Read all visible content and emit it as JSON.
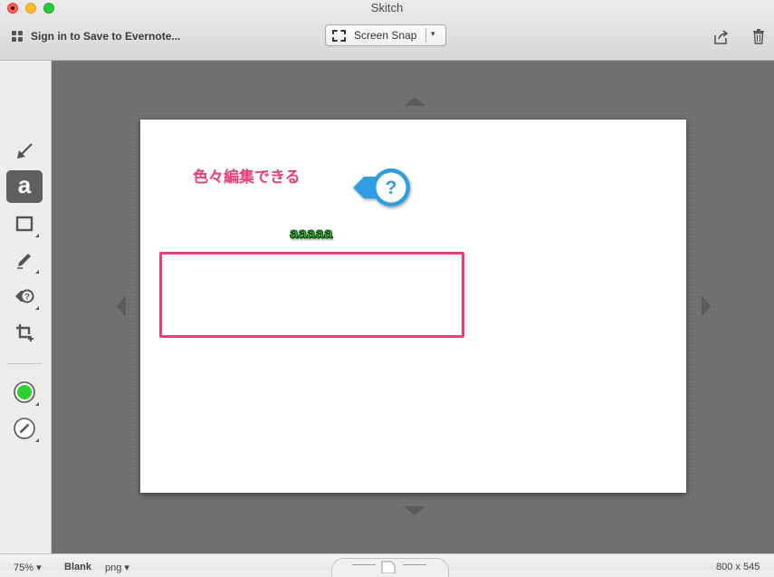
{
  "window": {
    "title": "Skitch"
  },
  "toolbar": {
    "signin_label": "Sign in to Save to Evernote...",
    "snap_label": "Screen Snap",
    "snap_arrow": "▾"
  },
  "palette": {
    "tools": [
      "arrow-icon",
      "text-icon",
      "rectangle-icon",
      "marker-icon",
      "callout-tool-icon",
      "crop-icon"
    ],
    "text_tool_glyph": "a",
    "color_swatch": "#2fd12f",
    "stroke_icon": "stroke-width-icon"
  },
  "canvas": {
    "annotation_jp": "色々編集できる",
    "annotation_green": "aaaaa",
    "callout_glyph": "?",
    "accent_pink": "#ea3d7a",
    "accent_green": "#2ec82e",
    "callout_blue": "#2d9ee0"
  },
  "statusbar": {
    "zoom": "75% ▾",
    "background": "Blank",
    "format": "png ▾",
    "dimensions": "800 x 545"
  }
}
